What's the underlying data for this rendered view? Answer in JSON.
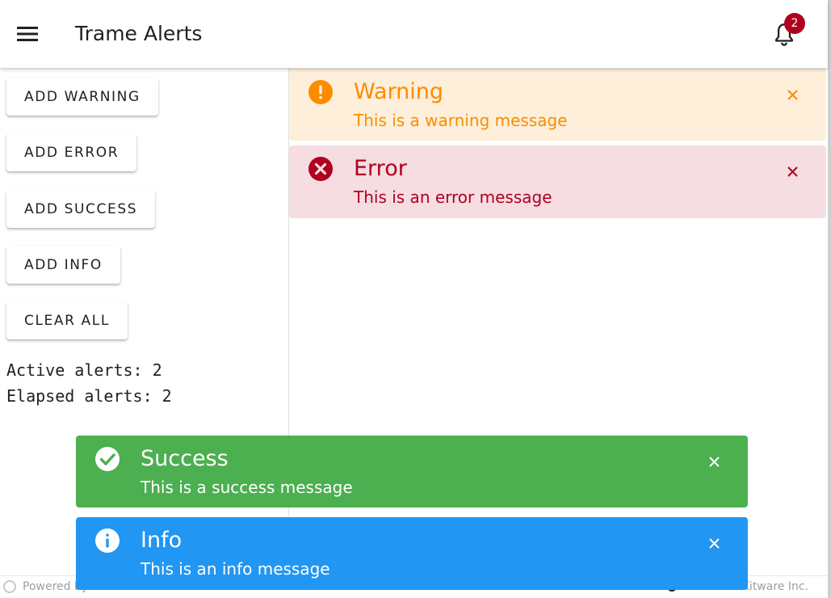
{
  "header": {
    "title": "Trame Alerts",
    "notification_count": "2"
  },
  "controls": {
    "buttons": [
      {
        "label": "ADD WARNING"
      },
      {
        "label": "ADD ERROR"
      },
      {
        "label": "ADD SUCCESS"
      },
      {
        "label": "ADD INFO"
      },
      {
        "label": "CLEAR ALL"
      }
    ],
    "stats": {
      "active": "Active alerts: 2",
      "elapsed": "Elapsed alerts: 2"
    }
  },
  "alerts": {
    "warning": {
      "title": "Warning",
      "text": "This is a warning message",
      "color": "#fb8c00",
      "background": "#fdefd9",
      "icon": "alert-circle-icon"
    },
    "error": {
      "title": "Error",
      "text": "This is an error message",
      "color": "#b00020",
      "background": "#f5dde1",
      "icon": "close-circle-icon"
    },
    "success": {
      "title": "Success",
      "text": "This is a success message",
      "color": "#ffffff",
      "background": "#4caf50",
      "icon": "check-circle-icon"
    },
    "info": {
      "title": "Info",
      "text": "This is an info message",
      "color": "#ffffff",
      "background": "#2196f3",
      "icon": "information-icon"
    }
  },
  "footer": {
    "powered": "Powered by trame",
    "copyright": "© 2024 Kitware Inc."
  }
}
